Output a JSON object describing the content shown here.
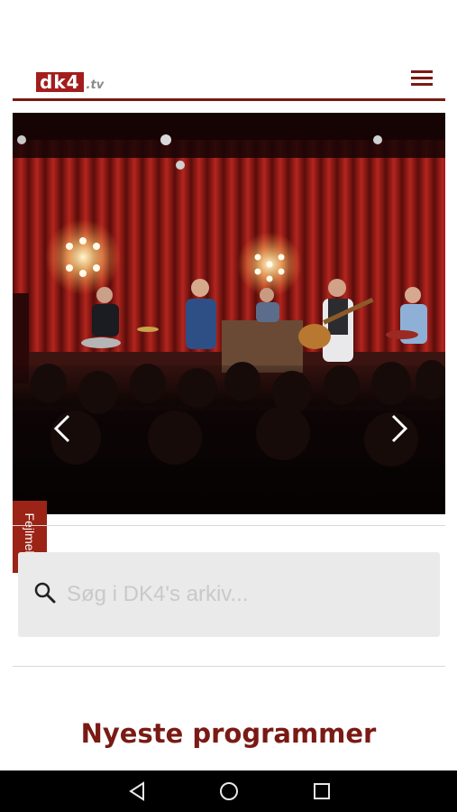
{
  "header": {
    "logo_main": "dk4",
    "logo_tld": ".tv",
    "menu_icon": "hamburger-menu-icon"
  },
  "carousel": {
    "image": "concert-stage-photo",
    "prev_icon": "chevron-left-icon",
    "next_icon": "chevron-right-icon"
  },
  "feedback": {
    "label": "Fejlmeld"
  },
  "search": {
    "placeholder": "Søg i DK4's arkiv...",
    "icon": "search-icon"
  },
  "section": {
    "title": "Nyeste programmer"
  },
  "navbar": {
    "back_icon": "back-triangle-icon",
    "home_icon": "home-circle-icon",
    "recents_icon": "recents-square-icon"
  },
  "colors": {
    "brand": "#7a1a14",
    "logo_bg": "#a31d1d",
    "feedback_bg": "#9b2416",
    "search_bg": "#eaeaea"
  }
}
